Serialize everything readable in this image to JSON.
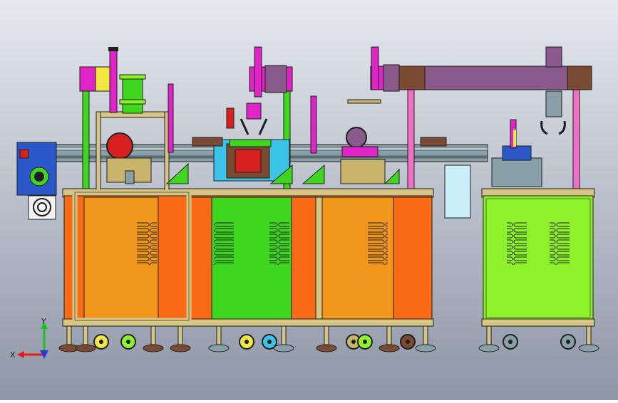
{
  "viewport": {
    "background_top": "#e6e9ee",
    "background_bottom": "#8d96a7"
  },
  "colors": {
    "orange": "#f0961a",
    "orange_red": "#fb6a14",
    "green": "#3fd61f",
    "lime": "#8ef22a",
    "tan": "#d7c586",
    "magenta": "#e024c8",
    "purple": "#8a5a8c",
    "brown": "#7b4a32",
    "steel": "#8aa0a8",
    "blue": "#2a58c8",
    "red": "#d82020",
    "yellow": "#f2e640",
    "cyan": "#3cc4e8",
    "khaki": "#c8b46a",
    "pale_cyan": "#c8eef8",
    "pink": "#f070c8",
    "dark": "#1e1e1e"
  },
  "triad": {
    "x_label": "X",
    "y_label": "Y",
    "x_color": "#e21c1c",
    "y_color": "#1ec21e",
    "z_color": "#2a3ad8"
  }
}
